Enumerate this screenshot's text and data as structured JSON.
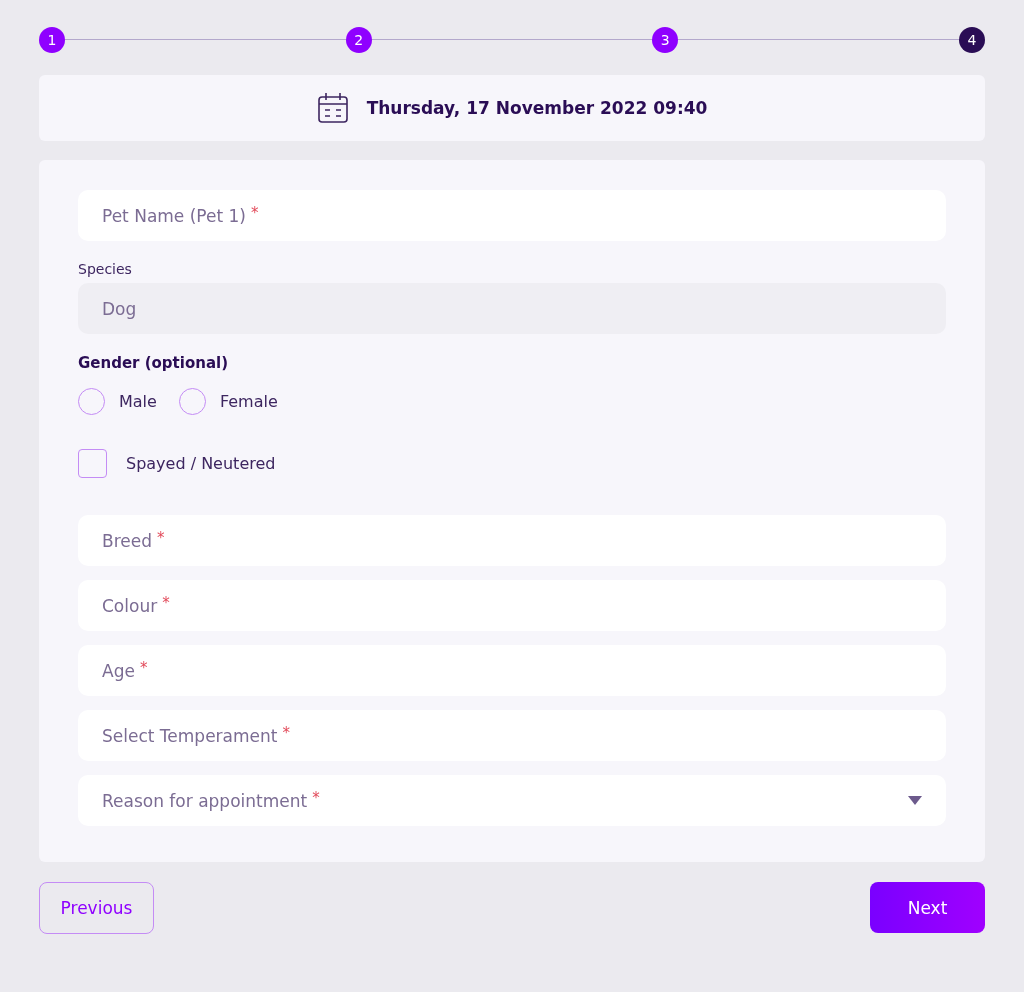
{
  "steps": [
    {
      "label": "1",
      "selected": false
    },
    {
      "label": "2",
      "selected": false
    },
    {
      "label": "3",
      "selected": false
    },
    {
      "label": "4",
      "selected": true
    }
  ],
  "appointment": {
    "datetime": "Thursday, 17 November 2022 09:40"
  },
  "form": {
    "pet_name": {
      "placeholder": "Pet Name (Pet 1)",
      "required_mark": "*"
    },
    "species": {
      "label": "Species",
      "value": "Dog",
      "disabled": true
    },
    "gender": {
      "label": "Gender (optional)",
      "options": [
        {
          "label": "Male",
          "selected": false
        },
        {
          "label": "Female",
          "selected": false
        }
      ]
    },
    "spayed": {
      "label": "Spayed / Neutered",
      "checked": false
    },
    "fields": [
      {
        "kind": "text",
        "placeholder": "Breed",
        "required_mark": "*"
      },
      {
        "kind": "text",
        "placeholder": "Colour",
        "required_mark": "*"
      },
      {
        "kind": "text",
        "placeholder": "Age",
        "required_mark": "*"
      },
      {
        "kind": "text",
        "placeholder": "Select Temperament",
        "required_mark": "*"
      },
      {
        "kind": "select",
        "placeholder": "Reason for appointment",
        "required_mark": "*"
      }
    ]
  },
  "buttons": {
    "previous": "Previous",
    "next": "Next"
  }
}
